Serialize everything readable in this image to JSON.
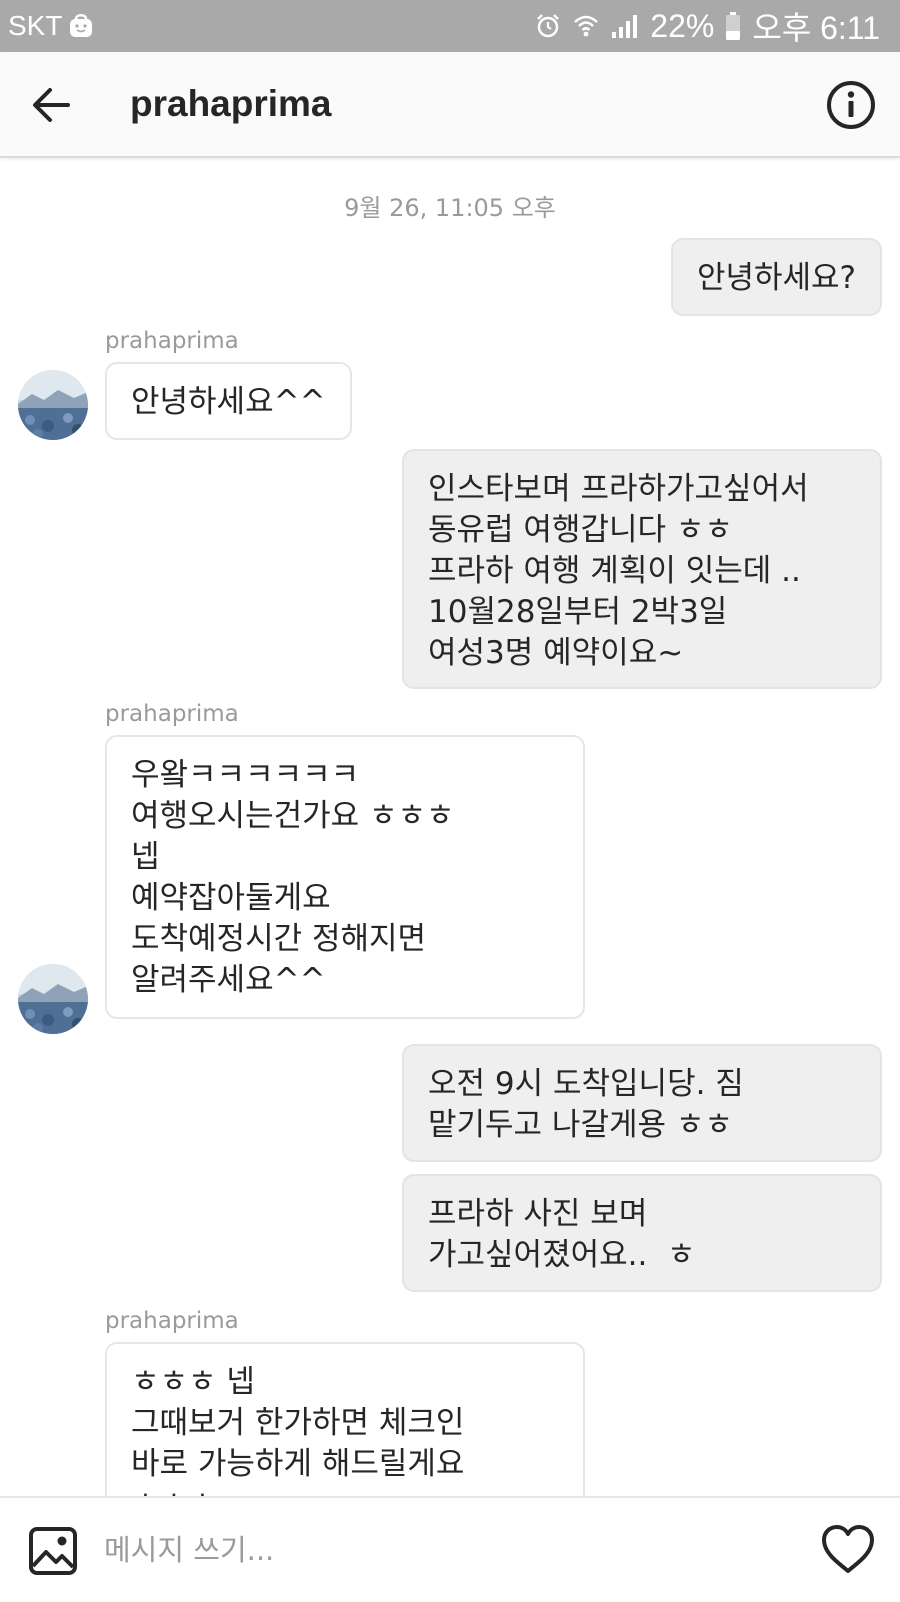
{
  "status_bar": {
    "carrier": "SKT",
    "battery_percent": "22%",
    "time": "오후 6:11"
  },
  "header": {
    "title": "prahaprima"
  },
  "conversation": {
    "timestamp": "9월 26, 11:05 오후",
    "sender_name": "prahaprima",
    "messages": [
      {
        "direction": "out",
        "text": "안녕하세요?"
      },
      {
        "direction": "in",
        "sender": "prahaprima",
        "text": "안녕하세요^^"
      },
      {
        "direction": "out",
        "text": "인스타보며 프라하가고싶어서\n동유럽 여행갑니다 ㅎㅎ\n프라하 여행 계획이 잇는데 ..\n10월28일부터 2박3일\n여성3명 예약이요~"
      },
      {
        "direction": "in",
        "sender": "prahaprima",
        "text": "우왘ㅋㅋㅋㅋㅋㅋ\n여행오시는건가요 ㅎㅎㅎ\n넵\n예약잡아둘게요\n도착예정시간 정해지면\n알려주세요^^"
      },
      {
        "direction": "out",
        "text": "오전 9시 도착입니당. 짐\n맡기두고 나갈게용 ㅎㅎ"
      },
      {
        "direction": "out",
        "text": "프라하 사진 보며\n가고싶어졌어요..  ㅎ"
      },
      {
        "direction": "in",
        "sender": "prahaprima",
        "text": "ㅎㅎㅎ 넵\n그때보거 한가하면 체크인\n바로 가능하게 해드릴게요\nㅎㅎㅎ"
      }
    ]
  },
  "input_bar": {
    "placeholder": "메시지 쓰기..."
  },
  "colors": {
    "status_bar_bg": "#a9a9a9",
    "outgoing_bubble": "#efefef",
    "incoming_bubble": "#ffffff",
    "secondary_text": "#9a9a9a"
  },
  "icons": {
    "back": "arrow-left-icon",
    "info": "info-icon",
    "gallery": "gallery-icon",
    "like": "heart-icon",
    "alarm": "alarm-icon",
    "wifi": "wifi-icon",
    "signal": "signal-icon",
    "battery": "battery-icon"
  }
}
